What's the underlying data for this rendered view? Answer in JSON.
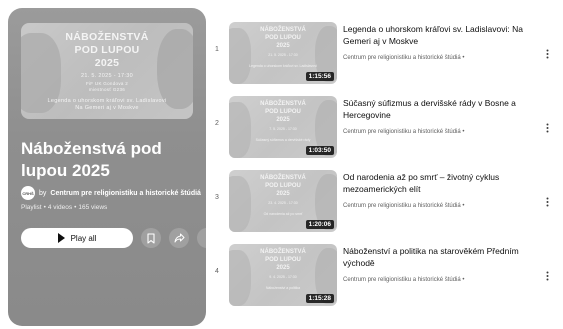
{
  "playlist": {
    "thumbnail_text": {
      "line1": "NÁBOŽENSTVÁ",
      "line2": "POD LUPOU",
      "line3": "2025",
      "line4": "21. 5. 2025 - 17:30",
      "line5": "FiF UK Gondova 2",
      "line6": "miestnosť G236",
      "line7": "Legenda o uhorskom kráľovi sv. Ladislavovi",
      "line8": "Na Gemeri aj v Moskve"
    },
    "title": "Náboženstvá pod lupou 2025",
    "owner_by": "by",
    "owner_name": "Centrum pre religionistiku a historické štúdiá",
    "avatar_text": "CRHŠ",
    "type": "Playlist",
    "video_count": "4 videos",
    "views": "165 views",
    "meta_sep": "•",
    "play_all_label": "Play all",
    "icons": {
      "play": "play-icon",
      "save": "bookmark-icon",
      "share": "share-icon",
      "more": "more-vertical-icon"
    }
  },
  "videos": [
    {
      "index": "1",
      "title": "Legenda o uhorskom kráľovi sv. Ladislavovi: Na Gemeri aj v Moskve",
      "channel": "Centrum pre religionistiku a historické štúdiá",
      "dot": "•",
      "duration": "1:15:56",
      "thumb": {
        "l1": "NÁBOŽENSTVÁ",
        "l2": "POD LUPOU",
        "l3": "2025",
        "l4": "21. 5. 2025 - 17:30",
        "l5": "Legenda o uhorskom kráľovi sv. Ladislavovi"
      }
    },
    {
      "index": "2",
      "title": "Súčasný súfizmus a dervišské rády v Bosne a Hercegovine",
      "channel": "Centrum pre religionistiku a historické štúdiá",
      "dot": "•",
      "duration": "1:03:50",
      "thumb": {
        "l1": "NÁBOŽENSTVÁ",
        "l2": "POD LUPOU",
        "l3": "2025",
        "l4": "7. 5. 2025 - 17:30",
        "l5": "Súčasný súfizmus a dervišské rády"
      }
    },
    {
      "index": "3",
      "title": "Od narodenia až po smrť – životný cyklus mezoamerických elít",
      "channel": "Centrum pre religionistiku a historické štúdiá",
      "dot": "•",
      "duration": "1:20:06",
      "thumb": {
        "l1": "NÁBOŽENSTVÁ",
        "l2": "POD LUPOU",
        "l3": "2025",
        "l4": "23. 4. 2025 - 17:30",
        "l5": "Od narodenia až po smrť"
      }
    },
    {
      "index": "4",
      "title": "Náboženství a politika na starověkém Předním východě",
      "channel": "Centrum pre religionistiku a historické štúdiá",
      "dot": "•",
      "duration": "1:15:28",
      "thumb": {
        "l1": "NÁBOŽENSTVÁ",
        "l2": "POD LUPOU",
        "l3": "2025",
        "l4": "9. 4. 2025 - 17:30",
        "l5": "Náboženství a politika"
      }
    }
  ],
  "colors": {
    "card_bg": "#8f8f8f",
    "text_primary": "#0f0f0f",
    "text_secondary": "#606060",
    "badge_bg": "#000000"
  }
}
